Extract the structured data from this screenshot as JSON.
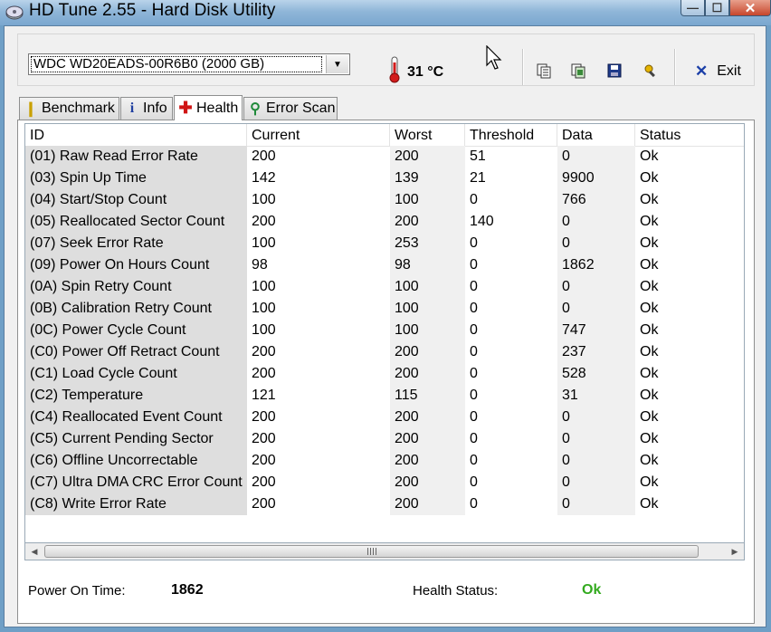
{
  "window": {
    "title": "HD Tune 2.55 - Hard Disk Utility",
    "minimize_glyph": "—",
    "maximize_glyph": "☐",
    "close_glyph": "✕"
  },
  "toolbar": {
    "drive_selected": "WDC WD20EADS-00R6B0 (2000 GB)",
    "temperature": "31 °C",
    "exit_label": "Exit",
    "icons": [
      "copy-text-icon",
      "copy-screenshot-icon",
      "save-icon",
      "options-icon"
    ]
  },
  "tabs": [
    {
      "label": "Benchmark",
      "icon": "benchmark-icon"
    },
    {
      "label": "Info",
      "icon": "info-icon"
    },
    {
      "label": "Health",
      "icon": "health-cross-icon",
      "active": true
    },
    {
      "label": "Error Scan",
      "icon": "magnifier-icon"
    }
  ],
  "table": {
    "columns": [
      "ID",
      "Current",
      "Worst",
      "Threshold",
      "Data",
      "Status"
    ],
    "rows": [
      [
        "(01) Raw Read Error Rate",
        "200",
        "200",
        "51",
        "0",
        "Ok"
      ],
      [
        "(03) Spin Up Time",
        "142",
        "139",
        "21",
        "9900",
        "Ok"
      ],
      [
        "(04) Start/Stop Count",
        "100",
        "100",
        "0",
        "766",
        "Ok"
      ],
      [
        "(05) Reallocated Sector Count",
        "200",
        "200",
        "140",
        "0",
        "Ok"
      ],
      [
        "(07) Seek Error Rate",
        "100",
        "253",
        "0",
        "0",
        "Ok"
      ],
      [
        "(09) Power On Hours Count",
        "98",
        "98",
        "0",
        "1862",
        "Ok"
      ],
      [
        "(0A) Spin Retry Count",
        "100",
        "100",
        "0",
        "0",
        "Ok"
      ],
      [
        "(0B) Calibration Retry Count",
        "100",
        "100",
        "0",
        "0",
        "Ok"
      ],
      [
        "(0C) Power Cycle Count",
        "100",
        "100",
        "0",
        "747",
        "Ok"
      ],
      [
        "(C0) Power Off Retract Count",
        "200",
        "200",
        "0",
        "237",
        "Ok"
      ],
      [
        "(C1) Load Cycle Count",
        "200",
        "200",
        "0",
        "528",
        "Ok"
      ],
      [
        "(C2) Temperature",
        "121",
        "115",
        "0",
        "31",
        "Ok"
      ],
      [
        "(C4) Reallocated Event Count",
        "200",
        "200",
        "0",
        "0",
        "Ok"
      ],
      [
        "(C5) Current Pending Sector",
        "200",
        "200",
        "0",
        "0",
        "Ok"
      ],
      [
        "(C6) Offline Uncorrectable",
        "200",
        "200",
        "0",
        "0",
        "Ok"
      ],
      [
        "(C7) Ultra DMA CRC Error Count",
        "200",
        "200",
        "0",
        "0",
        "Ok"
      ],
      [
        "(C8) Write Error Rate",
        "200",
        "200",
        "0",
        "0",
        "Ok"
      ]
    ]
  },
  "footer": {
    "power_on_label": "Power On Time:",
    "power_on_value": "1862",
    "health_label": "Health Status:",
    "health_value": "Ok"
  },
  "colors": {
    "health_ok": "#33aa1f",
    "id_column_bg": "#dedede"
  }
}
